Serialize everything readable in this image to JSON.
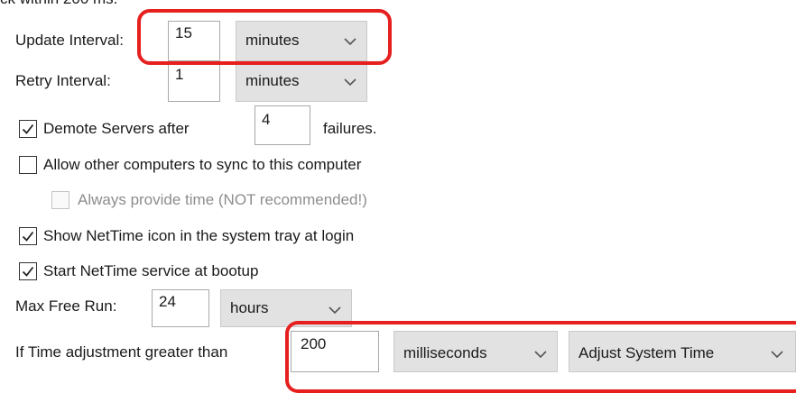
{
  "top_fragment": "ck within 200 ms.",
  "update_interval": {
    "label": "Update Interval:",
    "value": "15",
    "unit": "minutes"
  },
  "retry_interval": {
    "label": "Retry Interval:",
    "value": "1",
    "unit": "minutes"
  },
  "demote": {
    "checked": true,
    "label": "Demote Servers after",
    "value": "4",
    "suffix": "failures."
  },
  "allow_sync": {
    "checked": false,
    "label": "Allow other computers to sync to this computer"
  },
  "always_provide": {
    "checked": false,
    "disabled": true,
    "label": "Always provide time (NOT recommended!)"
  },
  "show_icon": {
    "checked": true,
    "label": "Show NetTime icon in the system tray at login"
  },
  "start_service": {
    "checked": true,
    "label": "Start NetTime service at bootup"
  },
  "max_free_run": {
    "label": "Max Free Run:",
    "value": "24",
    "unit": "hours"
  },
  "time_adjust": {
    "label": "If Time adjustment greater than",
    "value": "200",
    "unit": "milliseconds",
    "action": "Adjust System Time"
  },
  "colors": {
    "highlight": "#e5201f",
    "select_bg": "#e2e2e2",
    "input_border": "#a9a9a9"
  },
  "icons": {
    "checkbox_checked": "check-mark-icon",
    "dropdown": "chevron-down-icon"
  }
}
